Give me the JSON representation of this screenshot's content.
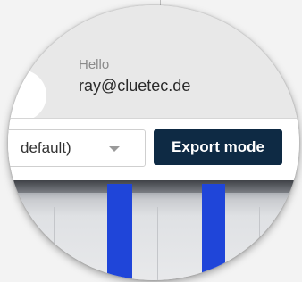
{
  "user": {
    "greeting": "Hello",
    "email": "ray@cluetec.de"
  },
  "toolbar": {
    "select_value": "default)",
    "export_label": "Export mode"
  },
  "colors": {
    "export_button_bg": "#0e2a44",
    "stripe_blue": "#1f45d9"
  }
}
